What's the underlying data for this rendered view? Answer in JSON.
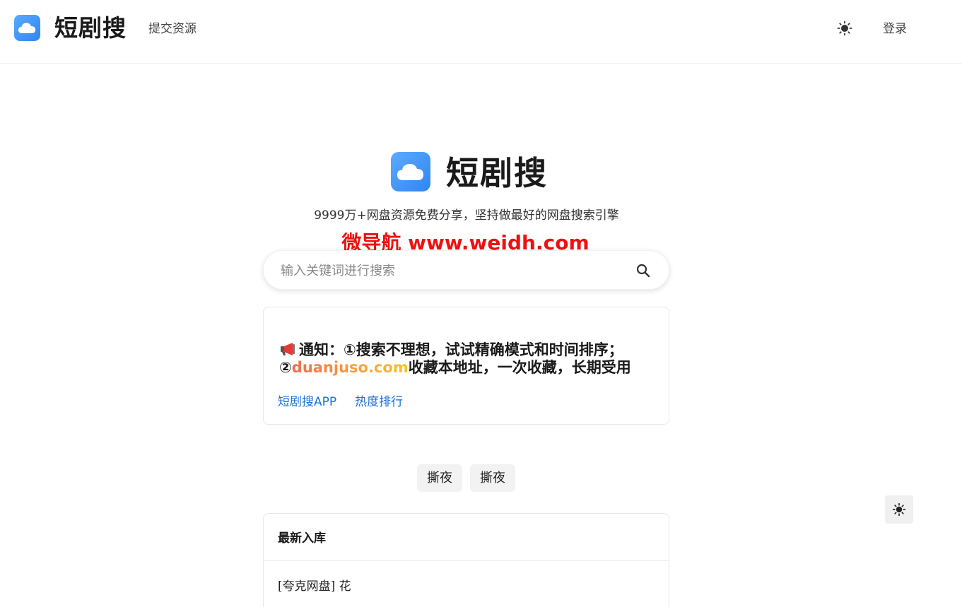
{
  "header": {
    "brand": "短剧搜",
    "nav_submit": "提交资源",
    "login": "登录"
  },
  "hero": {
    "brand": "短剧搜",
    "tagline": "9999万+网盘资源免费分享，坚持做最好的网盘搜索引擎",
    "watermark": "微导航 www.weidh.com"
  },
  "search": {
    "placeholder": "输入关键词进行搜索",
    "value": ""
  },
  "notice": {
    "line1": "通知：①搜索不理想，试试精确模式和时间排序；",
    "line2_prefix": "②",
    "domain": "duanjuso.com",
    "line2_suffix": "收藏本地址，一次收藏，长期受用",
    "links": [
      "短剧搜APP",
      "热度排行"
    ]
  },
  "hot_tags": [
    "撕夜",
    "撕夜"
  ],
  "latest": {
    "title": "最新入库",
    "items": [
      "[夸克网盘] 花"
    ]
  },
  "colors": {
    "brand_blue": "#2f86f3",
    "link": "#1e6fd9",
    "watermark_red": "#ee1111"
  },
  "icons": {
    "logo": "cloud-icon",
    "theme": "sun-icon",
    "search": "search-icon",
    "notice": "megaphone-icon"
  }
}
